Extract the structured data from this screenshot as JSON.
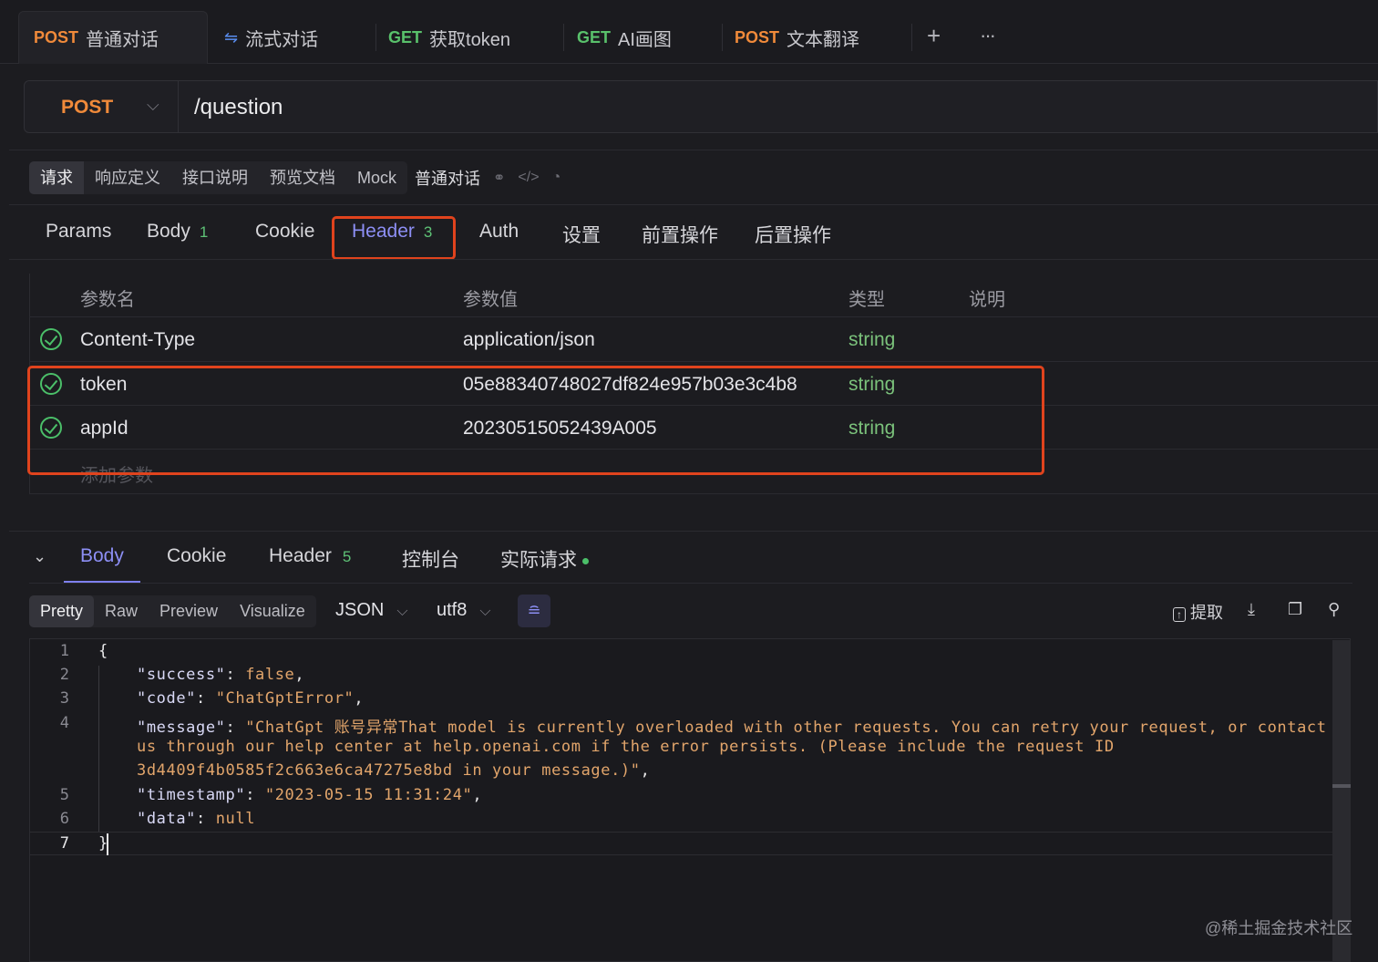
{
  "tabs": [
    {
      "method": "POST",
      "label": "普通对话"
    },
    {
      "method": "",
      "label": "流式对话"
    },
    {
      "method": "GET",
      "label": "获取token"
    },
    {
      "method": "GET",
      "label": "AI画图"
    },
    {
      "method": "POST",
      "label": "文本翻译"
    }
  ],
  "tab_actions": {
    "add": "+",
    "more": "···"
  },
  "url_bar": {
    "method": "POST",
    "path": "/question"
  },
  "sub_tabs": [
    "请求",
    "响应定义",
    "接口说明",
    "预览文档",
    "Mock"
  ],
  "api_name": "普通对话",
  "request_tabs": [
    {
      "label": "Params",
      "badge": ""
    },
    {
      "label": "Body",
      "badge": "1"
    },
    {
      "label": "Cookie",
      "badge": ""
    },
    {
      "label": "Header",
      "badge": "3"
    },
    {
      "label": "Auth",
      "badge": ""
    },
    {
      "label": "设置",
      "badge": ""
    },
    {
      "label": "前置操作",
      "badge": ""
    },
    {
      "label": "后置操作",
      "badge": ""
    }
  ],
  "header_table": {
    "columns": [
      "参数名",
      "参数值",
      "类型",
      "说明"
    ],
    "rows": [
      {
        "name": "Content-Type",
        "value": "application/json",
        "type": "string"
      },
      {
        "name": "token",
        "value": "05e88340748027df824e957b03e3c4b8",
        "type": "string"
      },
      {
        "name": "appId",
        "value": "20230515052439A005",
        "type": "string"
      }
    ],
    "add_placeholder": "添加参数"
  },
  "response_tabs": [
    {
      "label": "Body",
      "badge": ""
    },
    {
      "label": "Cookie",
      "badge": ""
    },
    {
      "label": "Header",
      "badge": "5"
    },
    {
      "label": "控制台",
      "badge": ""
    },
    {
      "label": "实际请求",
      "badge": ""
    }
  ],
  "view_modes": [
    "Pretty",
    "Raw",
    "Preview",
    "Visualize"
  ],
  "format": "JSON",
  "encoding": "utf8",
  "tools": {
    "extract": "提取"
  },
  "code": {
    "line_numbers": [
      "1",
      "2",
      "3",
      "4",
      "5",
      "6",
      "7"
    ],
    "open": "{",
    "success_key": "\"success\"",
    "success_val": "false",
    "code_key": "\"code\"",
    "code_val": "\"ChatGptError\"",
    "message_key": "\"message\"",
    "message_val_1": "\"ChatGpt 账号异常That model is currently overloaded with other requests. You can retry your request, or contact",
    "message_val_2": "us through our help center at help.openai.com if the error persists. (Please include the request ID",
    "message_val_3": "3d4409f4b0585f2c663e6ca47275e8bd in your message.)\"",
    "timestamp_key": "\"timestamp\"",
    "timestamp_val": "\"2023-05-15 11:31:24\"",
    "data_key": "\"data\"",
    "data_val": "null",
    "close": "}"
  },
  "watermark": "@稀土掘金技术社区",
  "colors": {
    "accent": "#8d8ff5",
    "post": "#f08a3a",
    "get": "#59c16b",
    "highlight_box": "#e0431d"
  }
}
